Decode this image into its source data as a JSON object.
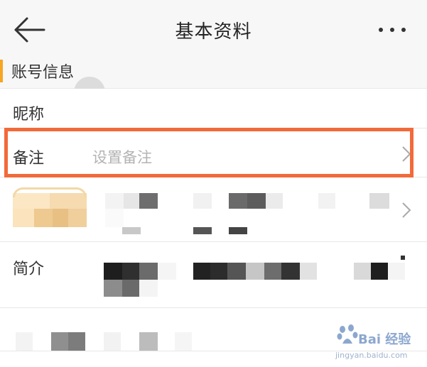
{
  "header": {
    "title": "基本资料",
    "back_icon": "arrow-left-icon",
    "more_icon": "more-horizontal-icon"
  },
  "section": {
    "label": "账号信息"
  },
  "rows": {
    "nickname": {
      "label": "昵称"
    },
    "remark": {
      "label": "备注",
      "placeholder": "设置备注"
    },
    "intro": {
      "label": "简介"
    }
  },
  "watermark": {
    "logo_text": "Bai 经验",
    "url": "jingyan.baidu.com"
  },
  "colors": {
    "accent_orange": "#f26a3a",
    "section_bar": "#f5a623",
    "placeholder": "#b3b3b3",
    "header_bg": "#f7f7f7"
  }
}
